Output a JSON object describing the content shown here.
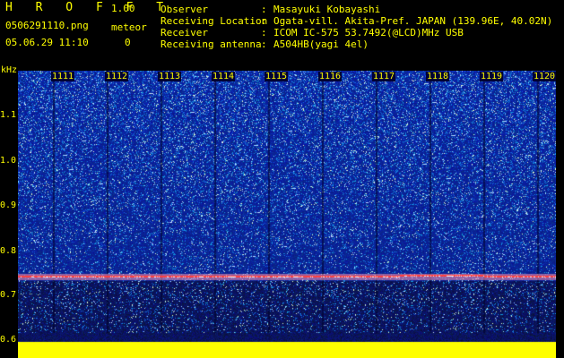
{
  "header": {
    "brand": "H R O F F T",
    "version": "1.00",
    "filename": "0506291110.png",
    "meteor_label": "meteor",
    "datetime": "05.06.29 11:10",
    "meteor_count": "0"
  },
  "info": [
    {
      "key": "Observer",
      "value": "Masayuki Kobayashi"
    },
    {
      "key": "Receiving Location",
      "value": "Ogata-vill. Akita-Pref. JAPAN (139.96E, 40.02N)"
    },
    {
      "key": "Receiver",
      "value": "ICOM IC-575 53.7492(@LCD)MHz USB"
    },
    {
      "key": "Receiving antenna",
      "value": "A504HB(yagi 4el)"
    }
  ],
  "y_axis": {
    "unit": "kHz",
    "labels": [
      "1.1",
      "1.0",
      "0.9",
      "0.8",
      "0.7",
      "0.6"
    ]
  },
  "x_axis": {
    "labels": [
      "1111",
      "1112",
      "1113",
      "1114",
      "1115",
      "1116",
      "1117",
      "1118",
      "1119",
      "1120"
    ]
  },
  "spectrogram": {
    "carrier_khz": 0.74,
    "colors": {
      "background": "#1030c0",
      "carrier": "#ff4040",
      "baseline": "#ffff00",
      "axis_text": "#ffff00"
    }
  }
}
